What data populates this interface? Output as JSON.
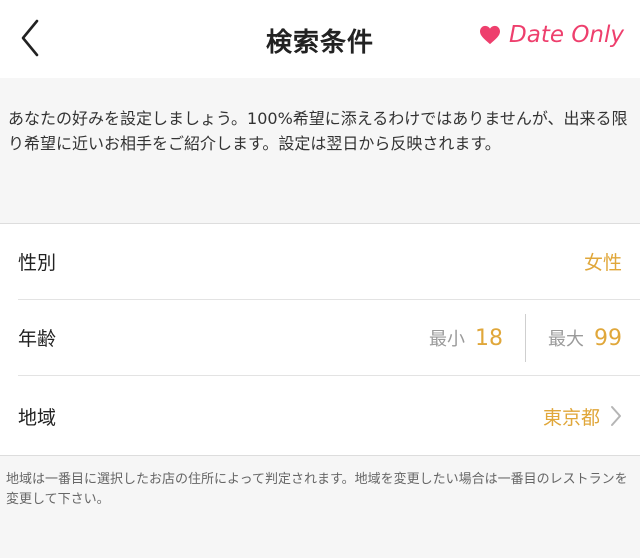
{
  "header": {
    "title": "検索条件",
    "date_only_label": "Date Only"
  },
  "intro": {
    "text": "あなたの好みを設定しましょう。100%希望に添えるわけではありませんが、出来る限り希望に近いお相手をご紹介します。設定は翌日から反映されます。"
  },
  "settings": {
    "gender": {
      "label": "性別",
      "value": "女性"
    },
    "age": {
      "label": "年齢",
      "min_caption": "最小",
      "min_value": "18",
      "max_caption": "最大",
      "max_value": "99"
    },
    "region": {
      "label": "地域",
      "value": "東京都"
    }
  },
  "note": {
    "text": "地域は一番目に選択したお店の住所によって判定されます。地域を変更したい場合は一番目のレストランを変更して下さい。"
  },
  "colors": {
    "accent_pink": "#ee3f6d",
    "value_gold": "#e0a73a",
    "caption_gray": "#9a9a9a"
  },
  "icons": {
    "back": "chevron-left-icon",
    "heart": "heart-icon",
    "disclosure": "chevron-right-icon"
  }
}
